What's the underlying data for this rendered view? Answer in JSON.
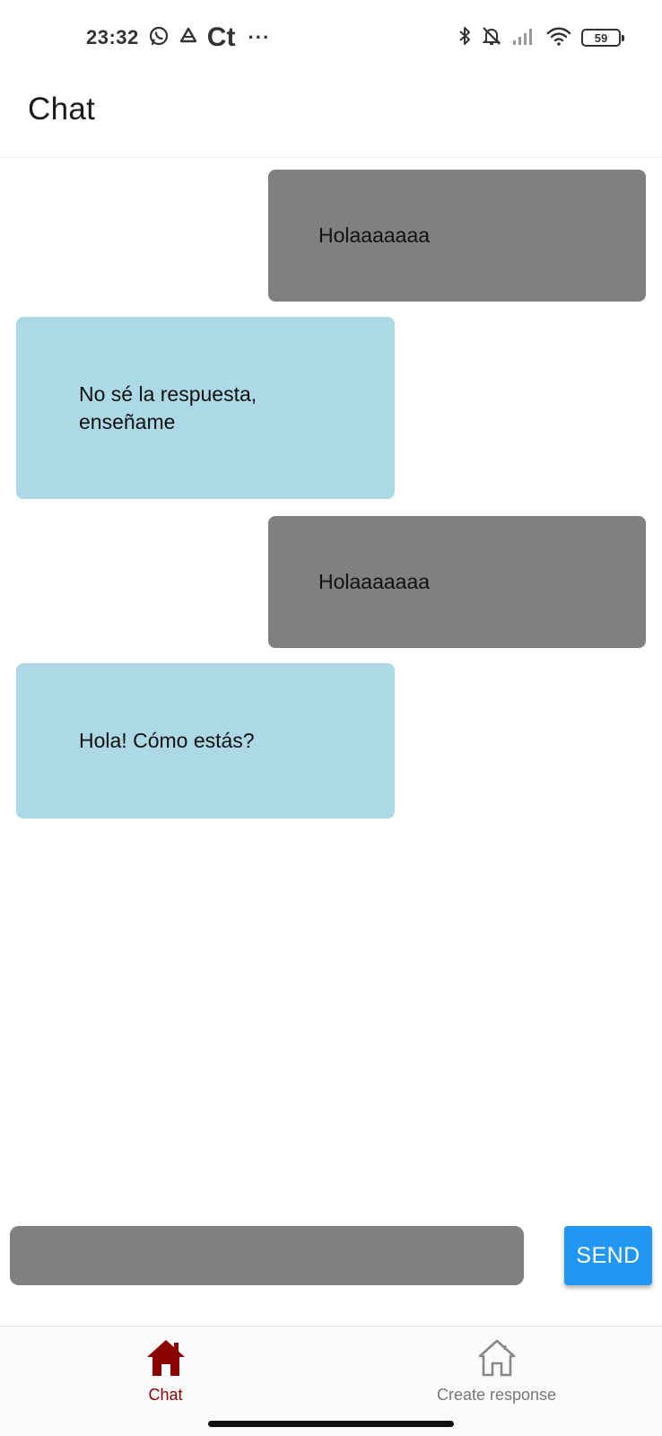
{
  "status_bar": {
    "time": "23:32",
    "app_text": "Ct",
    "overflow": "···",
    "battery": "59",
    "icons": [
      "whatsapp-icon",
      "drive-icon",
      "bluetooth-icon",
      "mute-icon",
      "signal-icon",
      "wifi-icon",
      "battery-icon"
    ]
  },
  "app_bar": {
    "title": "Chat"
  },
  "messages": [
    {
      "type": "sent",
      "text": "Holaaaaaaa"
    },
    {
      "type": "received",
      "text": "No sé la respuesta, enseñame"
    },
    {
      "type": "sent",
      "text": "Holaaaaaaa"
    },
    {
      "type": "received",
      "text": "Hola! Cómo estás?"
    }
  ],
  "composer": {
    "input_value": "",
    "send_label": "SEND"
  },
  "bottom_nav": {
    "items": [
      {
        "label": "Chat",
        "icon": "home-icon",
        "active": true
      },
      {
        "label": "Create response",
        "icon": "home-outline-icon",
        "active": false
      }
    ]
  },
  "colors": {
    "sent_bubble": "#808080",
    "received_bubble": "#add8e6",
    "send_button": "#2196f3",
    "nav_active": "#8b0000",
    "nav_inactive": "#777777"
  }
}
